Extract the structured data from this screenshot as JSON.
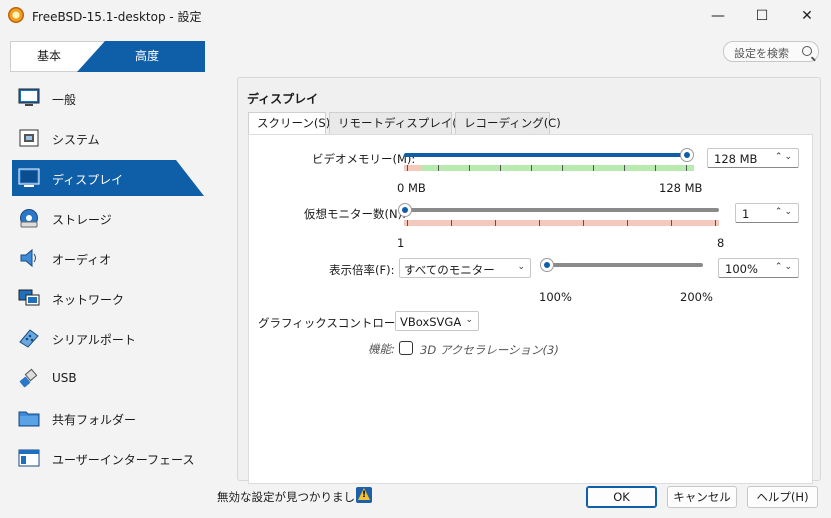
{
  "window": {
    "title": "FreeBSD-15.1-desktop - 設定",
    "minimize": "—",
    "maximize": "☐",
    "close": "✕"
  },
  "mode_tabs": {
    "basic": "基本",
    "advanced": "高度"
  },
  "search": {
    "placeholder": "設定を検索"
  },
  "sidebar": {
    "items": [
      {
        "label": "一般",
        "icon": "monitor-general-icon"
      },
      {
        "label": "システム",
        "icon": "chip-icon"
      },
      {
        "label": "ディスプレイ",
        "icon": "display-icon",
        "active": true
      },
      {
        "label": "ストレージ",
        "icon": "disk-icon"
      },
      {
        "label": "オーディオ",
        "icon": "speaker-icon"
      },
      {
        "label": "ネットワーク",
        "icon": "network-icon"
      },
      {
        "label": "シリアルポート",
        "icon": "serial-port-icon"
      },
      {
        "label": "USB",
        "icon": "usb-icon"
      },
      {
        "label": "共有フォルダー",
        "icon": "folder-icon"
      },
      {
        "label": "ユーザーインターフェース",
        "icon": "ui-window-icon"
      }
    ]
  },
  "panel": {
    "title": "ディスプレイ",
    "tabs": [
      {
        "label": "スクリーン(S)",
        "active": true
      },
      {
        "label": "リモートディスプレイ(R)"
      },
      {
        "label": "レコーディング(C)"
      }
    ],
    "video_memory": {
      "label": "ビデオメモリー(M):",
      "value": "128 MB",
      "min_label": "0 MB",
      "max_label": "128 MB",
      "fraction": 1.0
    },
    "monitors": {
      "label": "仮想モニター数(N):",
      "value": "1",
      "min_label": "1",
      "max_label": "8",
      "fraction": 0.0
    },
    "scale": {
      "label": "表示倍率(F):",
      "target": "すべてのモニター",
      "value": "100%",
      "min_label": "100%",
      "max_label": "200%",
      "fraction": 0.0
    },
    "controller": {
      "label": "グラフィックスコントローラー(G):",
      "value": "VBoxSVGA"
    },
    "features": {
      "label": "機能:",
      "acceleration_label": "3D アクセラレーション(3)",
      "acceleration_checked": false
    }
  },
  "footer": {
    "warning_text": "無効な設定が見つかりました",
    "ok": "OK",
    "cancel": "キャンセル",
    "help": "ヘルプ(H)"
  },
  "colors": {
    "accent": "#0e5ea8",
    "band_green": "#b9eab0",
    "band_red": "#f4c8bd"
  }
}
